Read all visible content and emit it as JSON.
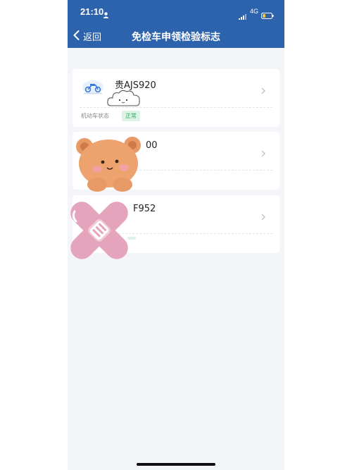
{
  "status_bar": {
    "time": "21:10",
    "network": "4G"
  },
  "nav": {
    "back_label": "返回",
    "title": "免检车申领检验标志"
  },
  "vehicles": [
    {
      "plate": "贵AJS920",
      "status_label": "机动车状态",
      "status": "正常"
    },
    {
      "plate": "",
      "status_label": "",
      "status": ""
    },
    {
      "plate": "",
      "status_label": "",
      "status": ""
    }
  ],
  "partial_text": {
    "card2_plate_tail": "00",
    "card3_plate_tail": "F952"
  },
  "colors": {
    "header": "#2d63ad",
    "badge_text": "#31a66a",
    "badge_bg": "#dcf4e6"
  },
  "icons": [
    "user-icon",
    "signal-icon",
    "battery-icon",
    "back-chevron-icon",
    "motorcycle-icon",
    "chevron-right-icon"
  ],
  "stickers": [
    "cloud-sticker",
    "bear-sticker",
    "bandage-sticker"
  ]
}
